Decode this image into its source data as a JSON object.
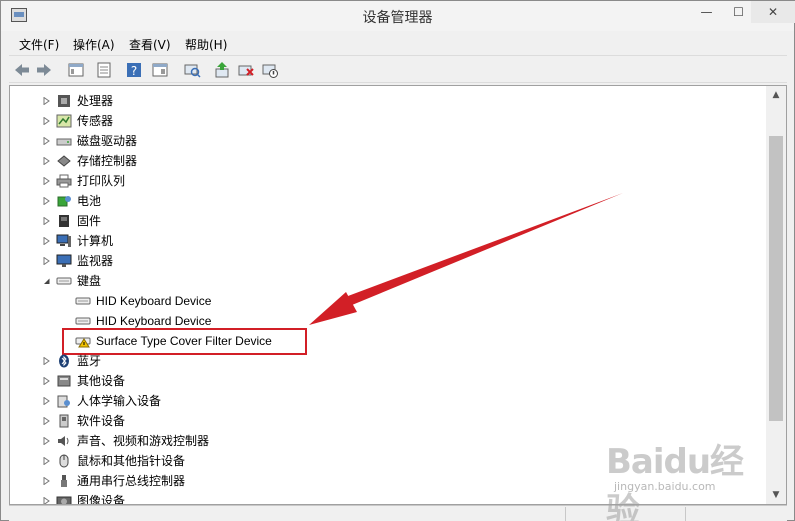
{
  "window": {
    "title": "设备管理器",
    "controls": {
      "minimize": "—",
      "maximize": "☐",
      "close": "✕"
    }
  },
  "menu": [
    {
      "label": "文件(F)"
    },
    {
      "label": "操作(A)"
    },
    {
      "label": "查看(V)"
    },
    {
      "label": "帮助(H)"
    }
  ],
  "toolbar": {
    "icons": [
      "back-arrow-icon",
      "forward-arrow-icon",
      "console-tree-icon",
      "properties-icon",
      "help-icon",
      "action-pane-icon",
      "scan-hardware-icon",
      "update-driver-icon",
      "uninstall-device-icon",
      "disable-device-icon"
    ]
  },
  "tree": {
    "categories": [
      {
        "label": "处理器",
        "icon": "processor-icon"
      },
      {
        "label": "传感器",
        "icon": "sensor-icon"
      },
      {
        "label": "磁盘驱动器",
        "icon": "disk-drive-icon"
      },
      {
        "label": "存储控制器",
        "icon": "storage-controller-icon"
      },
      {
        "label": "打印队列",
        "icon": "printer-icon"
      },
      {
        "label": "电池",
        "icon": "battery-icon"
      },
      {
        "label": "固件",
        "icon": "firmware-icon"
      },
      {
        "label": "计算机",
        "icon": "computer-icon"
      },
      {
        "label": "监视器",
        "icon": "monitor-icon"
      },
      {
        "label": "键盘",
        "icon": "keyboard-icon",
        "expanded": true
      },
      {
        "label": "蓝牙",
        "icon": "bluetooth-icon"
      },
      {
        "label": "其他设备",
        "icon": "other-devices-icon"
      },
      {
        "label": "人体学输入设备",
        "icon": "hid-icon"
      },
      {
        "label": "软件设备",
        "icon": "software-device-icon"
      },
      {
        "label": "声音、视频和游戏控制器",
        "icon": "sound-icon"
      },
      {
        "label": "鼠标和其他指针设备",
        "icon": "mouse-icon"
      },
      {
        "label": "通用串行总线控制器",
        "icon": "usb-icon"
      },
      {
        "label": "图像设备",
        "icon": "imaging-device-icon"
      }
    ],
    "keyboard_children": [
      {
        "label": "HID Keyboard Device",
        "icon": "keyboard-icon"
      },
      {
        "label": "HID Keyboard Device",
        "icon": "keyboard-icon"
      },
      {
        "label": "Surface Type Cover Filter Device",
        "icon": "warning-keyboard-icon",
        "highlighted": true
      }
    ]
  },
  "colors": {
    "highlight_border": "#d21f26",
    "annotation_arrow": "#d21f26",
    "scroll_thumb": "#c2c2c2"
  },
  "watermark": {
    "logo": "Baidu经验",
    "url": "jingyan.baidu.com"
  }
}
